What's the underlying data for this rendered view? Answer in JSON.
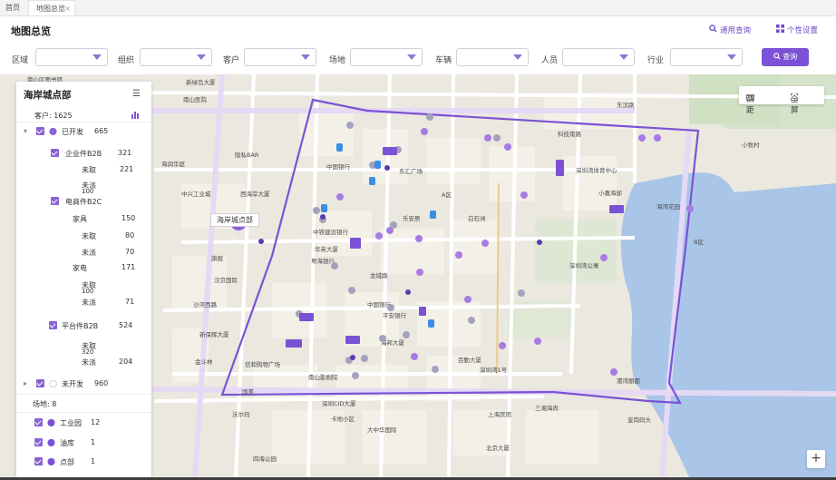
{
  "tabs": [
    {
      "label": "首页"
    },
    {
      "label": "地图总览",
      "close": "×"
    }
  ],
  "page_title": "地图总览",
  "header_actions": {
    "general_query": "通用查询",
    "personal_settings": "个性设置"
  },
  "filters": [
    {
      "label": "区域",
      "value": ""
    },
    {
      "label": "组织",
      "value": ""
    },
    {
      "label": "客户",
      "value": ""
    },
    {
      "label": "场地",
      "value": ""
    },
    {
      "label": "车辆",
      "value": ""
    },
    {
      "label": "人员",
      "value": ""
    },
    {
      "label": "行业",
      "value": ""
    }
  ],
  "query_button": "查询",
  "map_tools": {
    "measure": "测距",
    "fullscreen": "全屏"
  },
  "zoom_in": "+",
  "store_label": "海岸城点部",
  "accent_color": "#7b52d6",
  "panel": {
    "title": "海岸城点部",
    "customers_label": "客户: 1625",
    "developed": {
      "label": "已开发",
      "count": "665"
    },
    "b2b": {
      "label": "企业件B2B",
      "count": "321"
    },
    "b2b_untaken": {
      "label": "未取",
      "count": "221"
    },
    "b2b_undelivered": {
      "label": "未派",
      "count": "100"
    },
    "b2c": {
      "label": "电商件B2C"
    },
    "appliance": {
      "label": "家具",
      "count": "150"
    },
    "appliance_untaken": {
      "label": "未取",
      "count": "80"
    },
    "appliance_undelivered": {
      "label": "未派",
      "count": "70"
    },
    "electric": {
      "label": "家电",
      "count": "171"
    },
    "electric_untaken": {
      "label": "未取",
      "count": "100"
    },
    "electric_undelivered": {
      "label": "未派",
      "count": "71"
    },
    "platform": {
      "label": "平台件B2B",
      "count": "524"
    },
    "platform_untaken": {
      "label": "未取",
      "count": "320"
    },
    "platform_undelivered": {
      "label": "未派",
      "count": "204"
    },
    "undeveloped": {
      "label": "未开发",
      "count": "960"
    },
    "sites_label": "场地: 8",
    "site_industrial": {
      "label": "工业园",
      "count": "12"
    },
    "site_oil": {
      "label": "油库",
      "count": "1"
    },
    "site_point": {
      "label": "点部",
      "count": "1"
    }
  },
  "map_labels": {
    "l1": "南山区图书馆",
    "l2": "新绿岛大厦",
    "l3": "南山医院",
    "l4": "中国银行",
    "l5": "隐私BAR",
    "l6": "海润华庭",
    "l7": "中兴工业城",
    "l8": "西海岸大厦",
    "l9": "海岸城",
    "l10": "旗舰",
    "l11": "汉京国际",
    "l12": "沙河西路",
    "l13": "新保辉大厦",
    "l14": "金斗林",
    "l15": "信和购物广场",
    "l16": "南山影剧院",
    "l17": "国美",
    "l18": "深圳CID大厦",
    "l19": "卡地小区",
    "l20": "大中华国际",
    "l21": "沃尔玛",
    "l22": "四海公园",
    "l23": "上海宾馆",
    "l24": "三湘海尚",
    "l25": "深圳湾1号",
    "l26": "百勤大厦",
    "l27": "深圳湾体育中心",
    "l28": "小嘉海邸",
    "l29": "皇岗码头",
    "l30": "深圳湾公园",
    "l31": "科技南路",
    "l32": "东滨路",
    "l33": "中国银行",
    "l34": "平安银行",
    "l35": "龙城路",
    "l36": "华侨城",
    "l37": "A区",
    "l38": "B区",
    "l39": "海邦大厦",
    "l40": "中铁建设银行",
    "l41": "华英大厦",
    "l42": "粤海银行",
    "l43": "联合广场",
    "l44": "乐安居",
    "l45": "白石洲",
    "l46": "深圳湾公寓",
    "l47": "港湾丽都",
    "l48": "东汇广场",
    "l49": "深圳湾1号",
    "l50": "北京大厦",
    "l51": "小牧村",
    "l52": "深圳湾",
    "l53": "海湾花园",
    "l54": "海盛湾"
  }
}
